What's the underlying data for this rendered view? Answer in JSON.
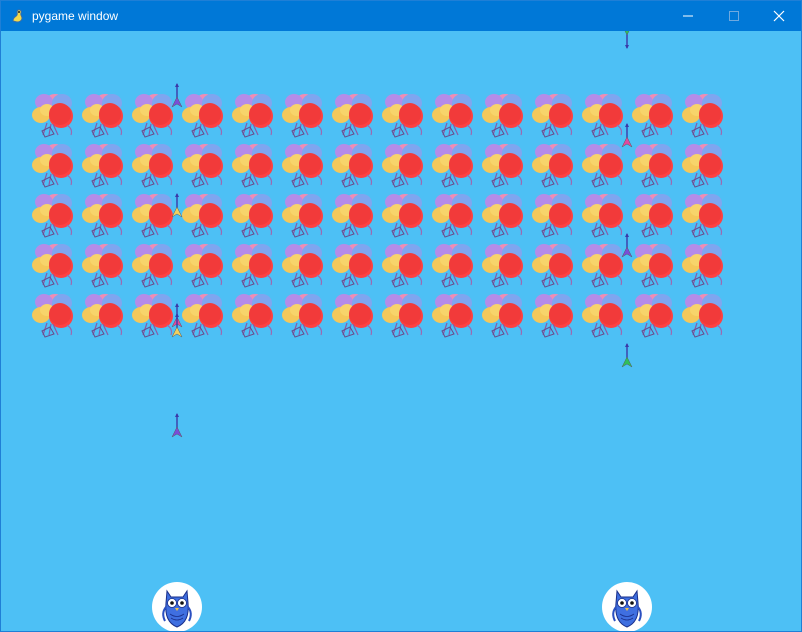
{
  "window": {
    "title": "pygame window",
    "app_icon": "pygame-snake-icon",
    "controls": [
      "minimize-icon",
      "maximize-icon",
      "close-icon"
    ]
  },
  "game": {
    "background_color": "#4dc0f5",
    "invaders": {
      "rows": 5,
      "columns": 14,
      "sprite": "balloon-bunch-with-red-ball"
    },
    "darts": [
      {
        "color": "#2fbf5a",
        "direction": "down"
      },
      {
        "color": "#7a4dd8",
        "direction": "up"
      },
      {
        "color": "#e04aa0",
        "direction": "up"
      },
      {
        "color": "#f0d060",
        "direction": "up"
      },
      {
        "color": "#7a4dd8",
        "direction": "up"
      },
      {
        "color": "#e04aa0",
        "direction": "up"
      },
      {
        "color": "#f0d060",
        "direction": "up"
      },
      {
        "color": "#2fbf5a",
        "direction": "up"
      },
      {
        "color": "#7a4dd8",
        "direction": "up"
      }
    ],
    "players": [
      {
        "sprite": "blue-owl-in-white-circle"
      },
      {
        "sprite": "blue-owl-in-white-circle"
      }
    ]
  }
}
